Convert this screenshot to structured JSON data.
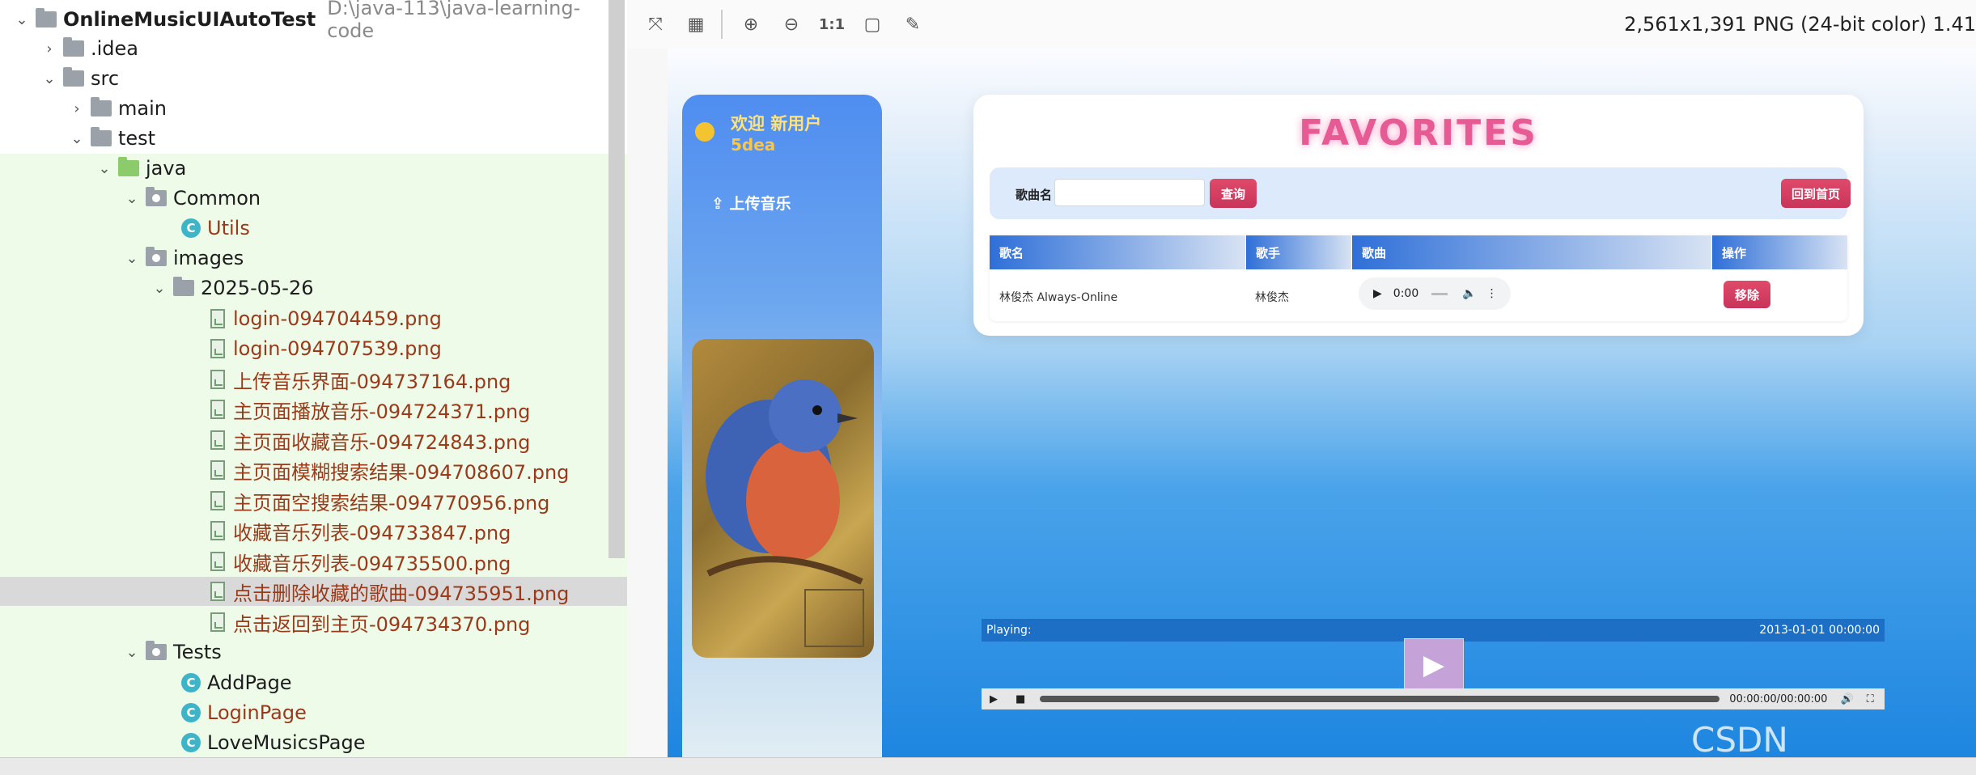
{
  "project_tree": {
    "root": {
      "name": "OnlineMusicUIAutoTest",
      "path": "D:\\java-113\\java-learning-code"
    },
    "items": [
      {
        "label": ".idea"
      },
      {
        "label": "src"
      },
      {
        "label": "main"
      },
      {
        "label": "test"
      },
      {
        "label": "java"
      },
      {
        "label": "Common"
      },
      {
        "label": "Utils"
      },
      {
        "label": "images"
      },
      {
        "label": "2025-05-26"
      },
      {
        "label": "login-094704459.png"
      },
      {
        "label": "login-094707539.png"
      },
      {
        "label": "上传音乐界面-094737164.png"
      },
      {
        "label": "主页面播放音乐-094724371.png"
      },
      {
        "label": "主页面收藏音乐-094724843.png"
      },
      {
        "label": "主页面模糊搜索结果-094708607.png"
      },
      {
        "label": "主页面空搜索结果-094770956.png"
      },
      {
        "label": "收藏音乐列表-094733847.png"
      },
      {
        "label": "收藏音乐列表-094735500.png"
      },
      {
        "label": "点击删除收藏的歌曲-094735951.png"
      },
      {
        "label": "点击返回到主页-094734370.png"
      },
      {
        "label": "Tests"
      },
      {
        "label": "AddPage"
      },
      {
        "label": "LoginPage"
      },
      {
        "label": "LoveMusicsPage"
      }
    ]
  },
  "viewer": {
    "image_info": "2,561x1,391 PNG (24-bit color) 1.41",
    "toolbar": {
      "zoom_1to1": "1:1"
    }
  },
  "app": {
    "sidebar": {
      "welcome": "欢迎 新用户",
      "username": "5dea",
      "upload": "上传音乐"
    },
    "favorites": {
      "title": "FAVORITES",
      "search_label": "歌曲名",
      "search_placeholder": "",
      "search_button": "查询",
      "home_button": "回到首页",
      "columns": [
        "歌名",
        "歌手",
        "歌曲",
        "操作"
      ],
      "rows": [
        {
          "title": "林俊杰 Always-Online",
          "artist": "林俊杰",
          "time": "0:00",
          "action": "移除"
        }
      ]
    },
    "player": {
      "playing_label": "Playing:",
      "timestamp": "2013-01-01 00:00:00",
      "time_display": "00:00:00/00:00:00"
    }
  },
  "watermark": "CSDN @Austin_Acc"
}
